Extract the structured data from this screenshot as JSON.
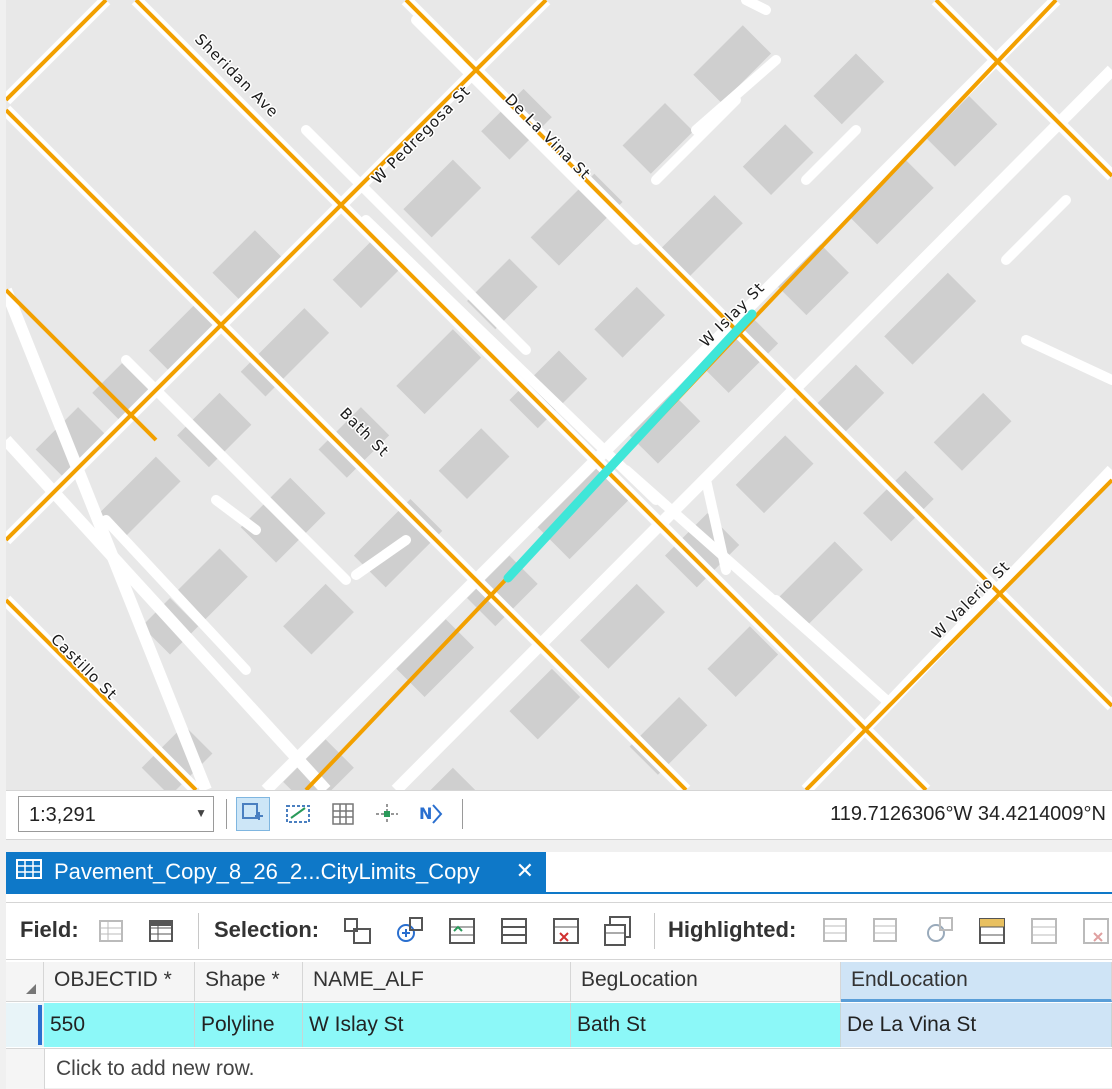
{
  "map": {
    "streets": {
      "sheridan": "Sheridan Ave",
      "pedregosa": "W Pedregosa St",
      "delavina": "De La Vina St",
      "islay": "W Islay St",
      "bath": "Bath St",
      "valerio": "W Valerio St",
      "castillo": "Castillo St"
    },
    "road_color": "#f2a000",
    "highlight_color": "#3fe6d8",
    "building_color": "#cfcfcf"
  },
  "statusbar": {
    "scale": "1:3,291",
    "coordinates": "119.7126306°W 34.4214009°N",
    "tools": [
      "select-extent-icon",
      "edit-vertices-icon",
      "grid-icon",
      "snapping-icon",
      "north-arrow-icon"
    ]
  },
  "table": {
    "tab_title": "Pavement_Copy_8_26_2...CityLimits_Copy",
    "close_glyph": "✕",
    "toolbar": {
      "field_label": "Field:",
      "selection_label": "Selection:",
      "highlighted_label": "Highlighted:"
    },
    "columns": [
      "OBJECTID *",
      "Shape *",
      "NAME_ALF",
      "BegLocation",
      "EndLocation"
    ],
    "rows": [
      [
        "550",
        "Polyline",
        "W Islay St",
        "Bath St",
        "De La Vina St"
      ]
    ],
    "new_row_text": "Click to add new row."
  }
}
